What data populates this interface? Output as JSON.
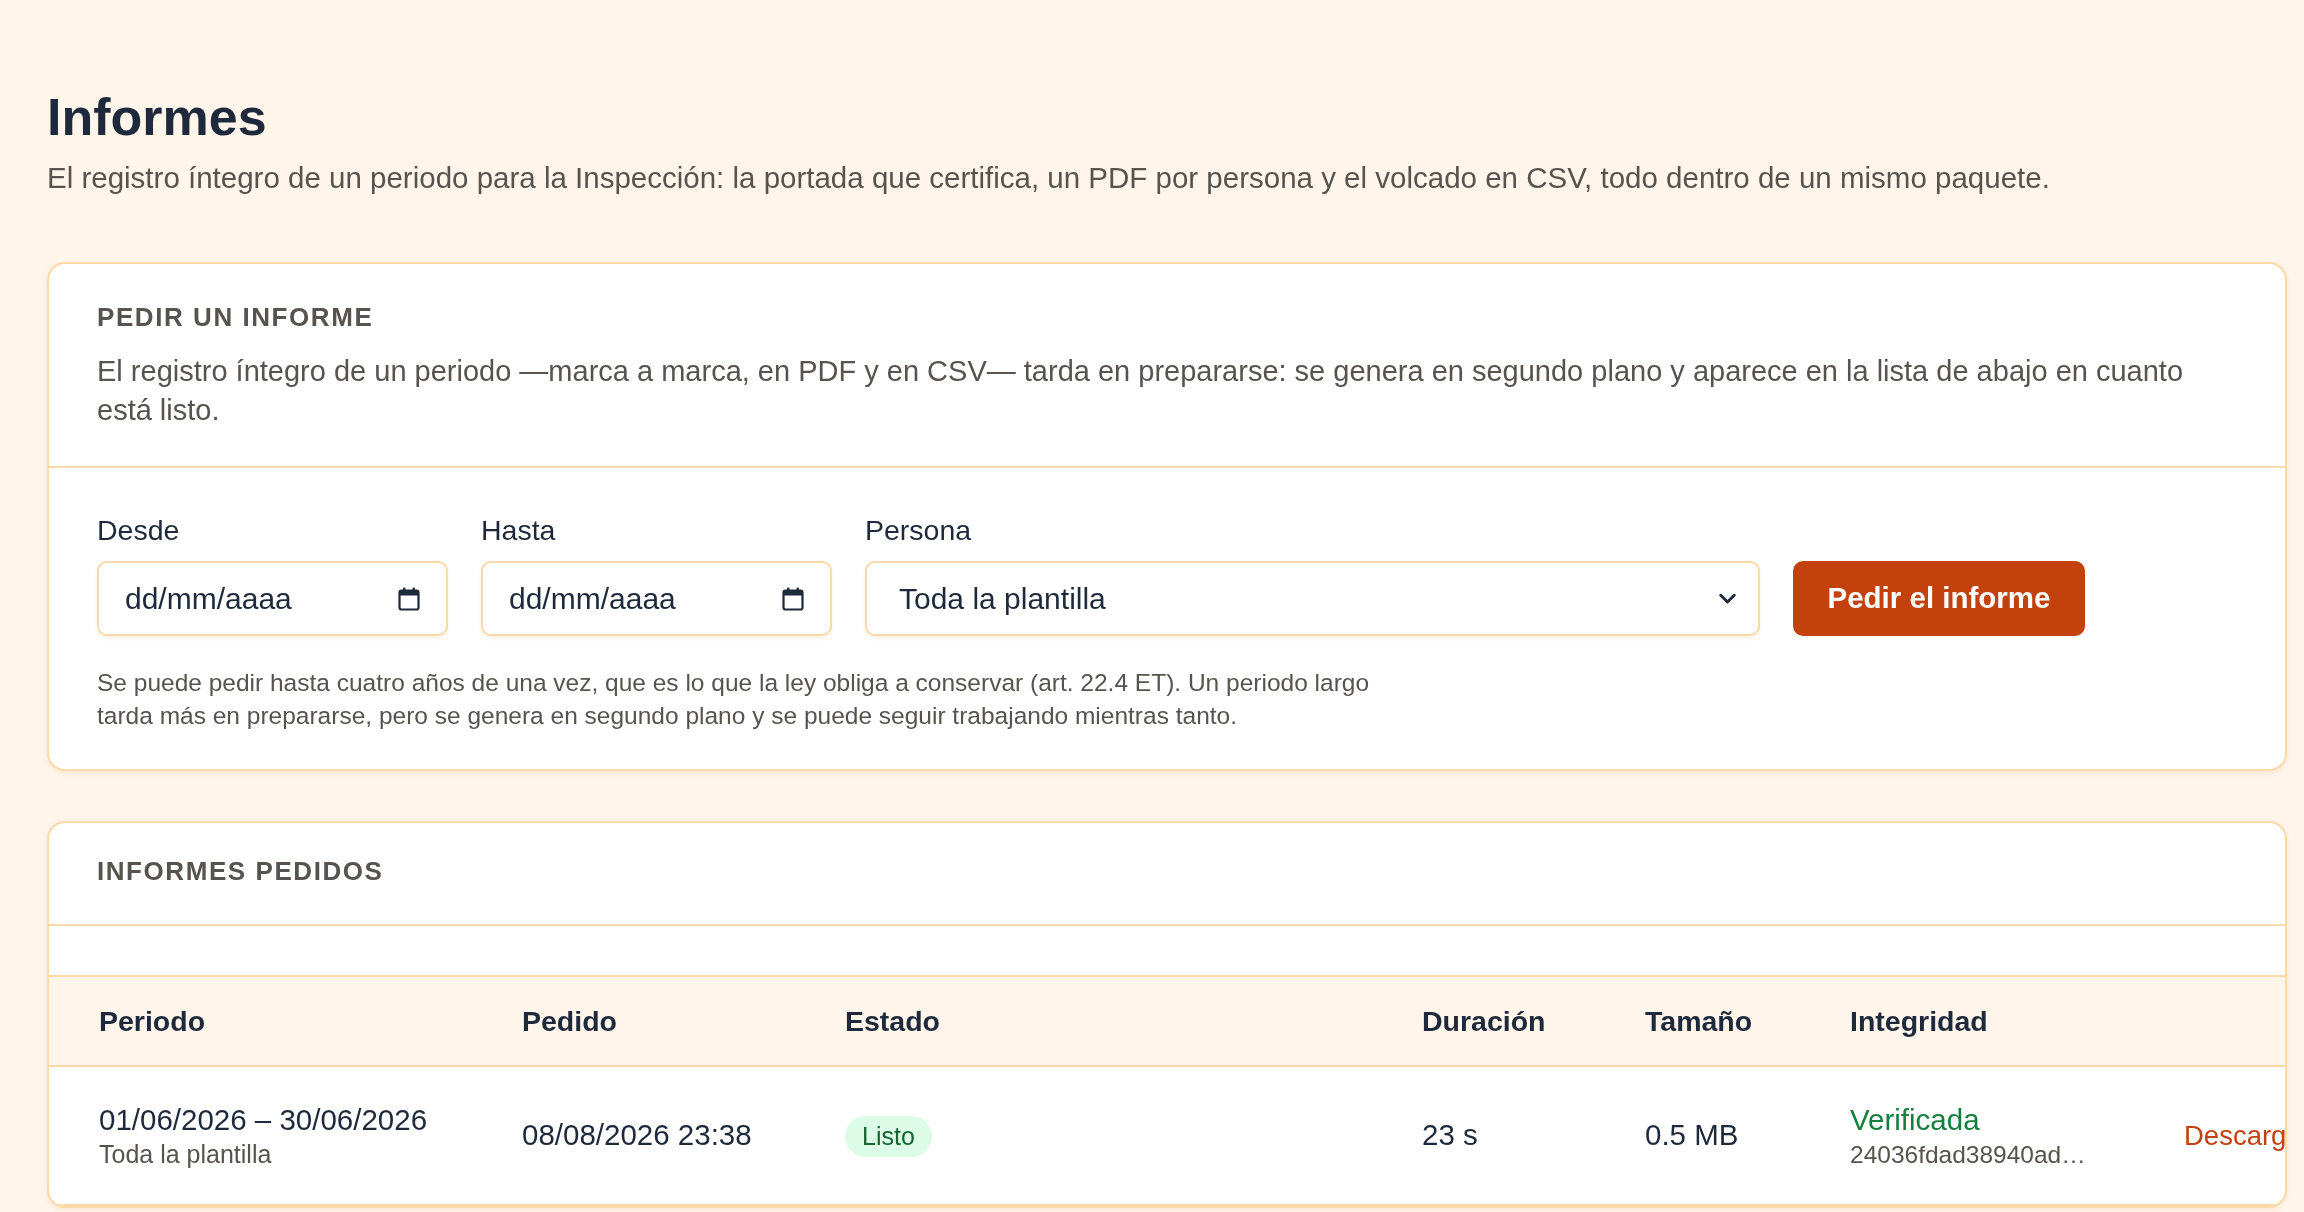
{
  "page": {
    "title": "Informes",
    "subtitle": "El registro íntegro de un periodo para la Inspección: la portada que certifica, un PDF por persona y el volcado en CSV, todo dentro de un mismo paquete."
  },
  "request_card": {
    "heading": "PEDIR UN INFORME",
    "description": "El registro íntegro de un periodo —marca a marca, en PDF y en CSV— tarda en prepararse: se genera en segundo plano y aparece en la lista de abajo en cuanto está listo.",
    "fields": [
      {
        "kind": "date",
        "label": "Desde",
        "placeholder": "dd/mm/aaaa"
      },
      {
        "kind": "date",
        "label": "Hasta",
        "placeholder": "dd/mm/aaaa"
      },
      {
        "kind": "select",
        "label": "Persona",
        "value": "Toda la plantilla"
      }
    ],
    "submit_button": "Pedir el informe",
    "help_text": "Se puede pedir hasta cuatro años de una vez, que es lo que la ley obliga a conservar (art. 22.4 ET). Un periodo largo tarda más en prepararse, pero se genera en segundo plano y se puede seguir trabajando mientras tanto."
  },
  "reports_card": {
    "heading": "INFORMES PEDIDOS",
    "table": {
      "columns": [
        "Periodo",
        "Pedido",
        "Estado",
        "Duración",
        "Tamaño",
        "Integridad"
      ],
      "rows": [
        {
          "period": "01/06/2026 – 30/06/2026",
          "scope": "Toda la plantilla",
          "requested": "08/08/2026 23:38",
          "status": {
            "kind": "ready",
            "label": "Listo"
          },
          "duration": "23 s",
          "size": "0.5 MB",
          "integrity": {
            "kind": "verified",
            "label": "Verificada",
            "hash": "24036fdad38940ad…"
          },
          "action": "Descarg"
        }
      ]
    }
  }
}
